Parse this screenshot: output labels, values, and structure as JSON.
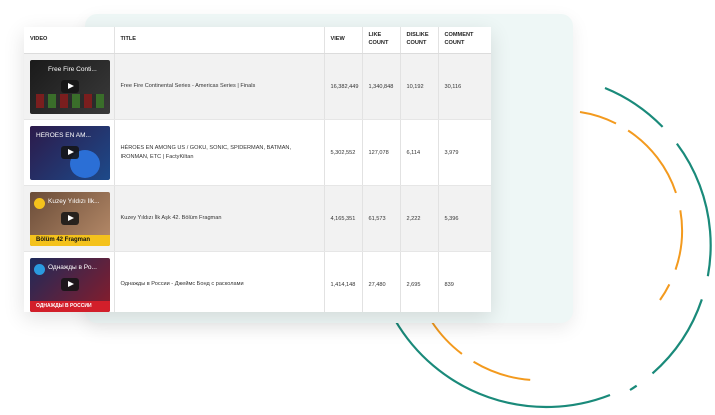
{
  "table": {
    "headers": {
      "video": "VIDEO",
      "title": "TITLE",
      "view": "VIEW",
      "like": "LIKE COUNT",
      "dislike": "DISLIKE COUNT",
      "comment": "COMMENT COUNT"
    },
    "rows": [
      {
        "thumb_title": "Free Fire Conti...",
        "title": "Free Fire Continental Series - Americas Series | Finals",
        "views": "16,382,449",
        "likes": "1,340,848",
        "dislikes": "10,192",
        "comments": "30,116"
      },
      {
        "thumb_title": "HÉROES EN AM...",
        "title": "HÉROES EN AMONG US / GOKU, SONIC, SPIDERMAN, BATMAN, IRONMAN, ETC | FactyKiltan",
        "views": "5,302,552",
        "likes": "127,078",
        "dislikes": "6,114",
        "comments": "3,979"
      },
      {
        "thumb_title": "Kuzey Yıldızı İlk...",
        "thumb_strip": "Bölüm 42 Fragman",
        "title": "Kuzey Yıldızı İlk Aşk 42. Bölüm Fragman",
        "views": "4,165,351",
        "likes": "61,573",
        "dislikes": "2,222",
        "comments": "5,396"
      },
      {
        "thumb_title": "Однажды в Ро...",
        "thumb_strip": "ОДНАЖДЫ В РОССИИ",
        "title": "Однажды в России - Джеймс Бонд с расколами",
        "views": "1,414,148",
        "likes": "27,480",
        "dislikes": "2,695",
        "comments": "839"
      }
    ]
  },
  "colors": {
    "arc_teal": "#1a8a7a",
    "arc_orange": "#f39a1e",
    "card_tint": "#eef7f6",
    "alt_row": "#f2f2f2"
  },
  "icons": [
    "play-icon"
  ]
}
